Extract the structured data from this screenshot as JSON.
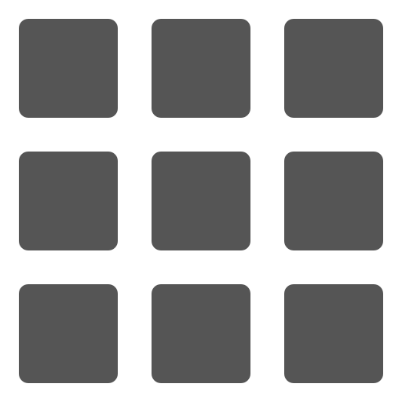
{
  "icon": {
    "name": "grid-icon",
    "color": "#555555",
    "background": "#ffffff",
    "rows": 3,
    "columns": 3
  }
}
